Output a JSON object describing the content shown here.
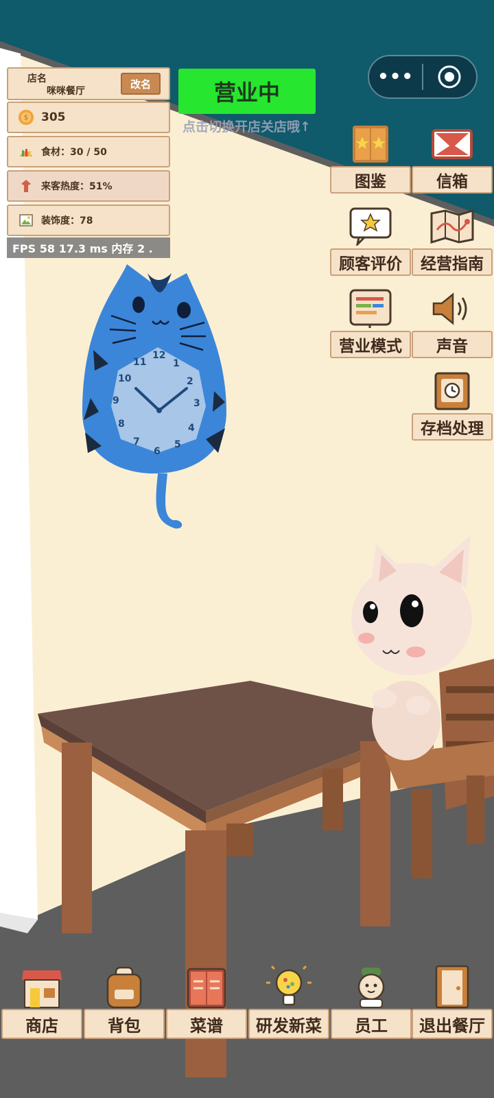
{
  "shop": {
    "name_label": "店名",
    "name_value": "咪咪餐厅",
    "rename_label": "改名"
  },
  "stats": {
    "coins": "305",
    "food": "食材：30 / 50",
    "heat": "来客热度：51%",
    "decor": "装饰度：78"
  },
  "debug": {
    "fps_text": "FPS 58   17.3 ms   内存 2 ."
  },
  "status": {
    "label": "营业中",
    "hint": "点击切换开店关店哦↑"
  },
  "capsule": {
    "more": "•••"
  },
  "side_menu": [
    {
      "label": "图鉴",
      "icon": "catalog-icon"
    },
    {
      "label": "信箱",
      "icon": "mail-icon"
    },
    {
      "label": "顾客评价",
      "icon": "review-icon"
    },
    {
      "label": "经营指南",
      "icon": "map-icon"
    },
    {
      "label": "营业模式",
      "icon": "mode-icon"
    },
    {
      "label": "声音",
      "icon": "sound-icon"
    },
    {
      "label": "存档处理",
      "icon": "save-icon"
    }
  ],
  "bottom_nav": [
    {
      "label": "商店",
      "icon": "shop-icon"
    },
    {
      "label": "背包",
      "icon": "bag-icon"
    },
    {
      "label": "菜谱",
      "icon": "recipe-icon"
    },
    {
      "label": "研发新菜",
      "icon": "idea-icon"
    },
    {
      "label": "员工",
      "icon": "staff-icon"
    },
    {
      "label": "退出餐厅",
      "icon": "exit-icon"
    }
  ],
  "clock": {
    "numbers": [
      "12",
      "1",
      "2",
      "3",
      "4",
      "5",
      "6",
      "7",
      "8",
      "9",
      "10",
      "11"
    ],
    "time": "10:10"
  },
  "colors": {
    "wall": "#fbefd3",
    "sky": "#0f5a6b",
    "floor": "#5e5e5e",
    "status_green": "#27e62f",
    "panel": "#f5e2c8",
    "panel_border": "#c9a07a"
  }
}
